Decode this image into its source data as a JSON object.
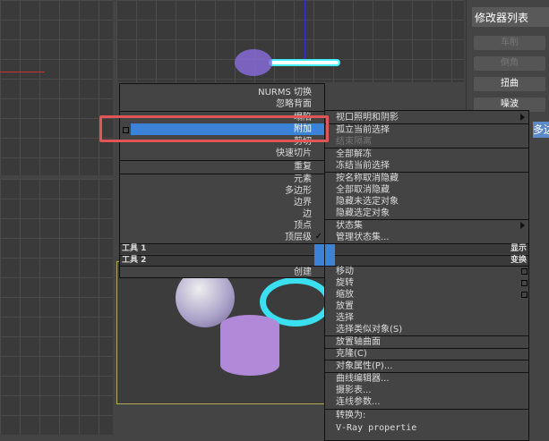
{
  "modifier_panel": {
    "title": "修改器列表",
    "buttons": [
      "车削",
      "倒角",
      "扭曲",
      "噪波"
    ],
    "partial_tab": "多边形"
  },
  "left_menu": {
    "items": [
      {
        "label": "NURMS 切换"
      },
      {
        "label": "忽略背面"
      },
      {
        "label": "塌陷"
      },
      {
        "label": "附加",
        "highlighted": true
      },
      {
        "label": "剪切"
      },
      {
        "label": "快速切片"
      },
      {
        "label": "重复"
      },
      {
        "label": "元素"
      },
      {
        "label": "多边形"
      },
      {
        "label": "边界"
      },
      {
        "label": "边"
      },
      {
        "label": "顶点"
      },
      {
        "label": "顶层级",
        "checked": true
      }
    ],
    "tools1": "工具 1",
    "tools2": "工具 2",
    "create": "创建",
    "check": "✓"
  },
  "right_menu": {
    "items": [
      {
        "label": "视口照明和阴影",
        "submenu": true
      },
      {
        "label": "孤立当前选择"
      },
      {
        "label": "结束隔离",
        "disabled": true
      },
      {
        "label": "全部解冻"
      },
      {
        "label": "冻结当前选择"
      },
      {
        "label": "按名称取消隐藏"
      },
      {
        "label": "全部取消隐藏"
      },
      {
        "label": "隐藏未选定对象"
      },
      {
        "label": "隐藏选定对象"
      },
      {
        "label": "状态集",
        "submenu": true
      },
      {
        "label": "管理状态集..."
      }
    ],
    "display": "显示",
    "transform": "变换",
    "items2": [
      {
        "label": "移动"
      },
      {
        "label": "旋转"
      },
      {
        "label": "缩放"
      },
      {
        "label": "放置"
      },
      {
        "label": "选择"
      },
      {
        "label": "选择类似对象(S)"
      },
      {
        "label": "放置轴曲面"
      },
      {
        "label": "克隆(C)"
      },
      {
        "label": "对象属性(P)..."
      },
      {
        "label": "曲线编辑器..."
      },
      {
        "label": "摄影表..."
      },
      {
        "label": "连线参数..."
      },
      {
        "label": "转换为:"
      },
      {
        "label": "V-Ray propertie"
      }
    ]
  },
  "colors": {
    "highlight": "#3c82d6",
    "annotation": "#e05555"
  }
}
